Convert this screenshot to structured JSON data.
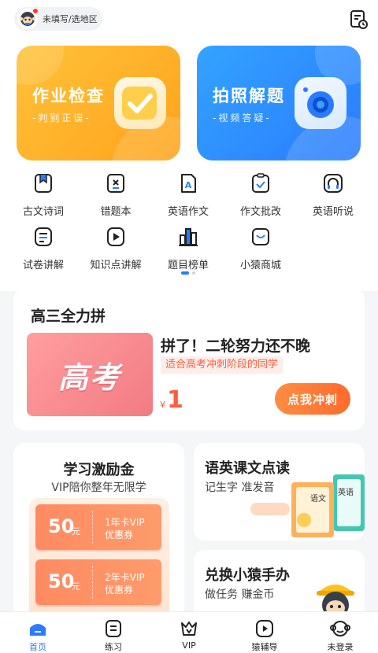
{
  "header": {
    "region_label": "未填写/选地区",
    "history_icon": "history-doc-icon"
  },
  "feature_cards": [
    {
      "title": "作业检查",
      "subtitle": "-判别正误-",
      "icon": "checkmark-icon",
      "color": "#ffad25"
    },
    {
      "title": "拍照解题",
      "subtitle": "-视频答疑-",
      "icon": "camera-icon",
      "color": "#2f8bff"
    }
  ],
  "tools": [
    {
      "label": "古文诗词",
      "icon": "bookmark-book-icon"
    },
    {
      "label": "错题本",
      "icon": "error-book-icon"
    },
    {
      "label": "英语作文",
      "icon": "english-doc-icon"
    },
    {
      "label": "作文批改",
      "icon": "essay-check-icon"
    },
    {
      "label": "英语听说",
      "icon": "headphones-icon"
    },
    {
      "label": "试卷讲解",
      "icon": "paper-icon"
    },
    {
      "label": "知识点讲解",
      "icon": "play-video-icon"
    },
    {
      "label": "题目榜单",
      "icon": "ranking-bars-icon"
    },
    {
      "label": "小猿商城",
      "icon": "shopping-bag-icon"
    }
  ],
  "promo": {
    "section_title": "高三全力拼",
    "banner_text": "高考",
    "headline": "拼了！二轮努力还不晚",
    "tag": "适合高考冲刺阶段的同学",
    "currency": "¥",
    "price": "1",
    "cta": "点我冲刺"
  },
  "incentive": {
    "title": "学习激励金",
    "subtitle": "VIP陪你整年无限学",
    "vouchers": [
      {
        "amount": "50",
        "unit": "元",
        "line1": "1年卡VIP",
        "line2": "优惠券"
      },
      {
        "amount": "50",
        "unit": "元",
        "line1": "2年卡VIP",
        "line2": "优惠券"
      }
    ]
  },
  "reading": {
    "title": "语英课文点读",
    "subtitle": "记生字 准发音",
    "book1": "语文",
    "book2": "英语"
  },
  "shop": {
    "title": "兑换小猿手办",
    "subtitle": "做任务 赚金币"
  },
  "tabbar": {
    "active": "首页",
    "tabs": [
      {
        "label": "首页",
        "icon": "home-icon"
      },
      {
        "label": "练习",
        "icon": "practice-icon"
      },
      {
        "label": "VIP",
        "icon": "vip-crown-icon"
      },
      {
        "label": "猿辅导",
        "icon": "video-play-icon"
      },
      {
        "label": "未登录",
        "icon": "monkey-avatar-icon"
      }
    ]
  },
  "colors": {
    "accent_blue": "#2a7bff",
    "accent_orange": "#ff5d3b"
  }
}
